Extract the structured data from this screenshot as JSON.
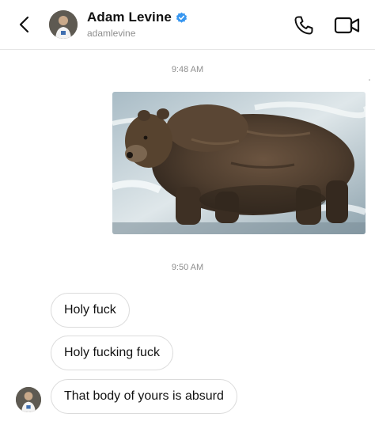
{
  "header": {
    "name": "Adam Levine",
    "username": "adamlevine",
    "verified": true,
    "back_icon": "chevron-left-icon",
    "call_icon": "phone-icon",
    "video_icon": "video-camera-icon",
    "accent_color": "#3897f0"
  },
  "thread": {
    "timestamp_1": "9:48 AM",
    "photo": {
      "subject": "brown-bear-photo"
    },
    "timestamp_2": "9:50 AM",
    "messages": [
      {
        "text": "Holy fuck"
      },
      {
        "text": "Holy fucking fuck"
      },
      {
        "text": "That body of yours is absurd"
      }
    ]
  }
}
